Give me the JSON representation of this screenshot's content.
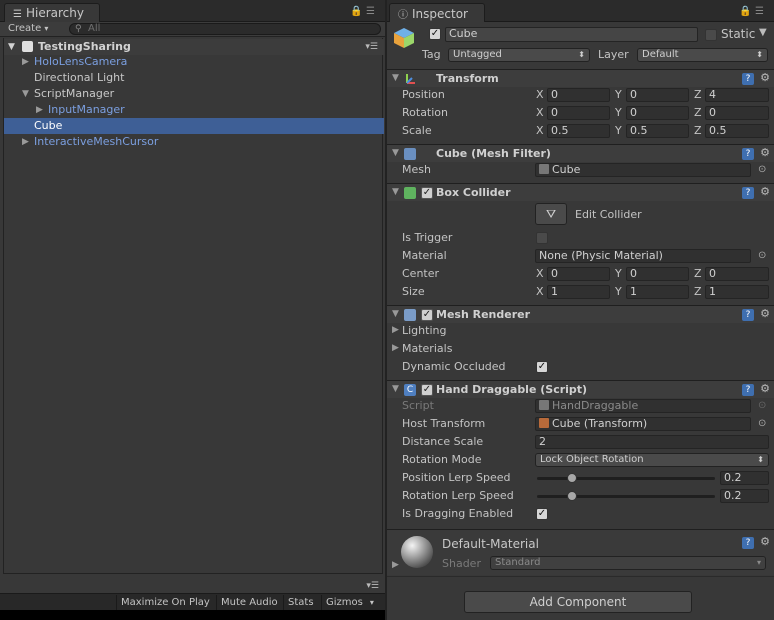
{
  "hierarchy": {
    "tab_label": "Hierarchy",
    "create_label": "Create",
    "search_placeholder": "All",
    "scene_name": "TestingSharing",
    "items": [
      {
        "label": "HoloLensCamera"
      },
      {
        "label": "Directional Light"
      },
      {
        "label": "ScriptManager"
      },
      {
        "label": "InputManager"
      },
      {
        "label": "Cube"
      },
      {
        "label": "InteractiveMeshCursor"
      }
    ]
  },
  "statusbar": {
    "maximize_on_play": "Maximize On Play",
    "mute_audio": "Mute Audio",
    "stats": "Stats",
    "gizmos": "Gizmos"
  },
  "inspector": {
    "tab_label": "Inspector",
    "object_name": "Cube",
    "static_label": "Static",
    "tag_label": "Tag",
    "tag_value": "Untagged",
    "layer_label": "Layer",
    "layer_value": "Default",
    "transform": {
      "title": "Transform",
      "position_label": "Position",
      "rotation_label": "Rotation",
      "scale_label": "Scale",
      "position": {
        "x": "0",
        "y": "0",
        "z": "4"
      },
      "rotation": {
        "x": "0",
        "y": "0",
        "z": "0"
      },
      "scale": {
        "x": "0.5",
        "y": "0.5",
        "z": "0.5"
      }
    },
    "mesh_filter": {
      "title": "Cube (Mesh Filter)",
      "mesh_label": "Mesh",
      "mesh_value": "Cube"
    },
    "box_collider": {
      "title": "Box Collider",
      "edit_collider": "Edit Collider",
      "is_trigger_label": "Is Trigger",
      "material_label": "Material",
      "material_value": "None (Physic Material)",
      "center_label": "Center",
      "size_label": "Size",
      "center": {
        "x": "0",
        "y": "0",
        "z": "0"
      },
      "size": {
        "x": "1",
        "y": "1",
        "z": "1"
      }
    },
    "mesh_renderer": {
      "title": "Mesh Renderer",
      "lighting_label": "Lighting",
      "materials_label": "Materials",
      "dynamic_occluded_label": "Dynamic Occluded"
    },
    "hand_draggable": {
      "title": "Hand Draggable (Script)",
      "script_label": "Script",
      "script_value": "HandDraggable",
      "host_transform_label": "Host Transform",
      "host_transform_value": "Cube (Transform)",
      "distance_scale_label": "Distance Scale",
      "distance_scale_value": "2",
      "rotation_mode_label": "Rotation Mode",
      "rotation_mode_value": "Lock Object Rotation",
      "position_lerp_label": "Position Lerp Speed",
      "position_lerp_value": "0.2",
      "rotation_lerp_label": "Rotation Lerp Speed",
      "rotation_lerp_value": "0.2",
      "dragging_enabled_label": "Is Dragging Enabled"
    },
    "material": {
      "name": "Default-Material",
      "shader_label": "Shader",
      "shader_value": "Standard"
    },
    "add_component": "Add Component"
  },
  "icons": {
    "hierarchy_tab": "list-icon",
    "inspector_tab": "info-icon",
    "lock": "lock-icon",
    "menu": "menu-icon",
    "gear": "gear-icon",
    "help": "help-icon"
  }
}
